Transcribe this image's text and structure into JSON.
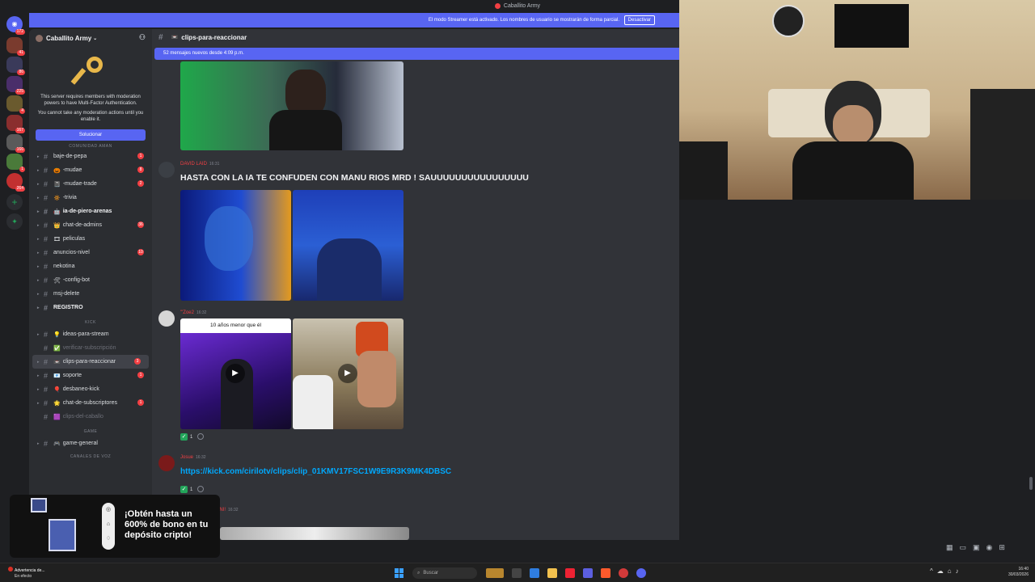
{
  "window": {
    "title": "Caballito Army"
  },
  "streamer_bar": {
    "text": "El modo Streamer está activado. Los nombres de usuario se mostrarán de forma parcial.",
    "button": "Desactivar"
  },
  "server_rail": {
    "badges": [
      "172",
      "41",
      "86",
      "225",
      "4",
      "167",
      "166",
      "1",
      "264"
    ]
  },
  "guild": {
    "name": "Caballito Army"
  },
  "mfa_notice": {
    "line1": "This server requires members with moderation powers to have Multi-Factor Authentication.",
    "line2": "You cannot take any moderation actions until you enable it.",
    "button": "Solucionar"
  },
  "categories": {
    "top": "COMUNIDAD AMAN",
    "kick": "KICK",
    "game": "GAME",
    "voice": "CANALES DE VOZ"
  },
  "channels": [
    {
      "name": "baje-de-pepa",
      "badge": "1"
    },
    {
      "name": "-mudae",
      "badge": "8"
    },
    {
      "name": "-mudae-trade",
      "badge": "2"
    },
    {
      "name": "-trivia",
      "badge": ""
    },
    {
      "name": "ia-de-piero-arenas",
      "badge": ""
    },
    {
      "name": "chat-de-admins",
      "badge": "36"
    },
    {
      "name": "peliculas",
      "badge": ""
    },
    {
      "name": "anuncios-nivel",
      "badge": "10"
    },
    {
      "name": "nekotina",
      "badge": ""
    },
    {
      "name": "-config-bot",
      "badge": ""
    },
    {
      "name": "msj-delete",
      "badge": ""
    },
    {
      "name": "REGISTRO",
      "badge": ""
    }
  ],
  "kick_channels": [
    {
      "name": "ideas-para-stream",
      "badge": ""
    },
    {
      "name": "verificar-subscripción",
      "badge": ""
    },
    {
      "name": "clips-para-reaccionar",
      "badge": "3"
    },
    {
      "name": "soporte",
      "badge": "1"
    },
    {
      "name": "desbaneo-kick",
      "badge": ""
    },
    {
      "name": "chat-de-subscriptores",
      "badge": "1"
    },
    {
      "name": "clips-del-caballo",
      "badge": ""
    }
  ],
  "game_channels": [
    {
      "name": "game-general",
      "badge": ""
    }
  ],
  "chat": {
    "channel": "clips-para-reaccionar",
    "new_messages": "52 mensajes nuevos desde 4:09 p.m.",
    "messages": [
      {
        "author": "DAVID LAID",
        "time": "16:31",
        "text": "HASTA CON LA IA TE CONFUDEN CON MANU RIOS MRD !  SAUUUUUUUUUUUUUUUU"
      },
      {
        "author": "\"'Zoe2",
        "time": "16:32",
        "caption": "10 años menor que él",
        "reaction_count": "1"
      },
      {
        "author": "Josue",
        "time": "16:32",
        "link": "https://kick.com/cirilotv/clips/clip_01KMV17FSC1W9E9R3K9MK4DBSC",
        "reaction_count": "1"
      },
      {
        "author": "JUANI!",
        "time": "16:32"
      }
    ]
  },
  "promo": {
    "text": "¡Obtén hasta un 600% de bono en tu depósito cripto!"
  },
  "taskbar": {
    "weather_line1": "Advertencia de...",
    "weather_line2": "En efecto",
    "search": "Buscar",
    "time": "16:40",
    "date": "30/03/2026"
  }
}
